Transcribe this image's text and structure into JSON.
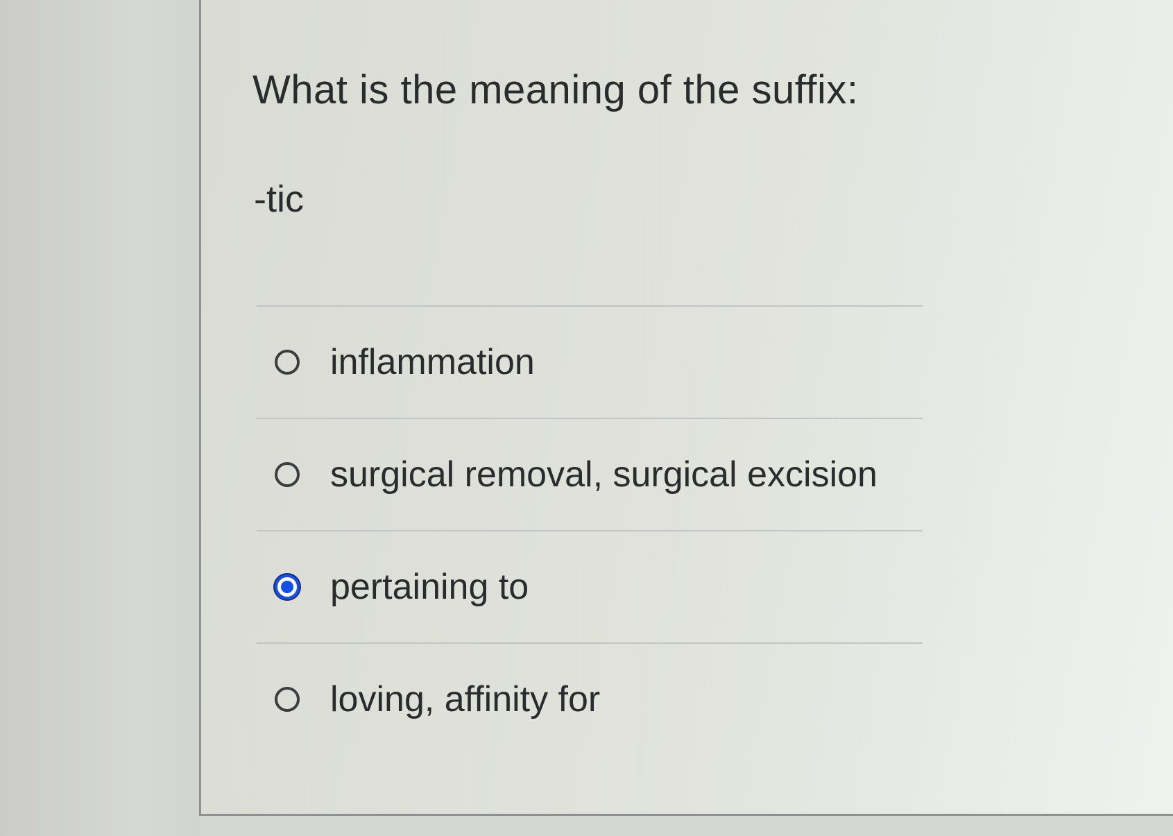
{
  "question": {
    "title": "What is the meaning of the suffix:",
    "term": "-tic"
  },
  "options": [
    {
      "label": "inflammation",
      "selected": false
    },
    {
      "label": "surgical removal, surgical excision",
      "selected": false
    },
    {
      "label": "pertaining to",
      "selected": true
    },
    {
      "label": "loving, affinity for",
      "selected": false
    }
  ],
  "colors": {
    "selected_radio": "#1550e4",
    "text": "#2a2b2c",
    "panel_border": "#8e9190"
  }
}
